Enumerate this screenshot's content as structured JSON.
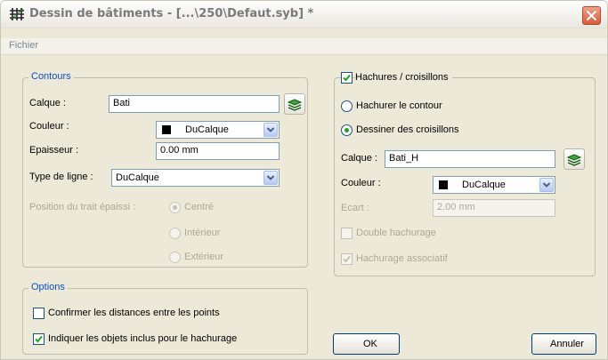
{
  "window": {
    "title": "Dessin de bâtiments - [...\\250\\Defaut.syb] *"
  },
  "menu": {
    "items": [
      "Fichier"
    ]
  },
  "contours": {
    "legend": "Contours",
    "calque_label": "Calque :",
    "calque_value": "Bati",
    "couleur_label": "Couleur :",
    "couleur_value": "DuCalque",
    "epaisseur_label": "Epaisseur :",
    "epaisseur_value": "0.00 mm",
    "type_ligne_label": "Type de ligne :",
    "type_ligne_value": "DuCalque",
    "position_label": "Position du trait épaissi :",
    "position_options": [
      "Centré",
      "Intérieur",
      "Extérieur"
    ],
    "position_selected": "Centré"
  },
  "hachures": {
    "legend": "Hachures / croisillons",
    "enabled": true,
    "mode_options": [
      "Hachurer le contour",
      "Dessiner des croisillons"
    ],
    "mode_selected": "Dessiner des croisillons",
    "calque_label": "Calque :",
    "calque_value": "Bati_H",
    "couleur_label": "Couleur :",
    "couleur_value": "DuCalque",
    "ecart_label": "Ecart :",
    "ecart_value": "2.00 mm",
    "double_label": "Double hachurage",
    "double_checked": false,
    "associatif_label": "Hachurage associatif",
    "associatif_checked": true
  },
  "options": {
    "legend": "Options",
    "confirm_label": "Confirmer les distances entre les points",
    "confirm_checked": false,
    "indiquer_label": "Indiquer les objets inclus pour le hachurage",
    "indiquer_checked": true
  },
  "buttons": {
    "ok": "OK",
    "cancel": "Annuler"
  },
  "colors": {
    "accent": "#0b4fc5",
    "disabled": "#aaa899",
    "face": "#ece9d8",
    "check": "#21a121"
  }
}
